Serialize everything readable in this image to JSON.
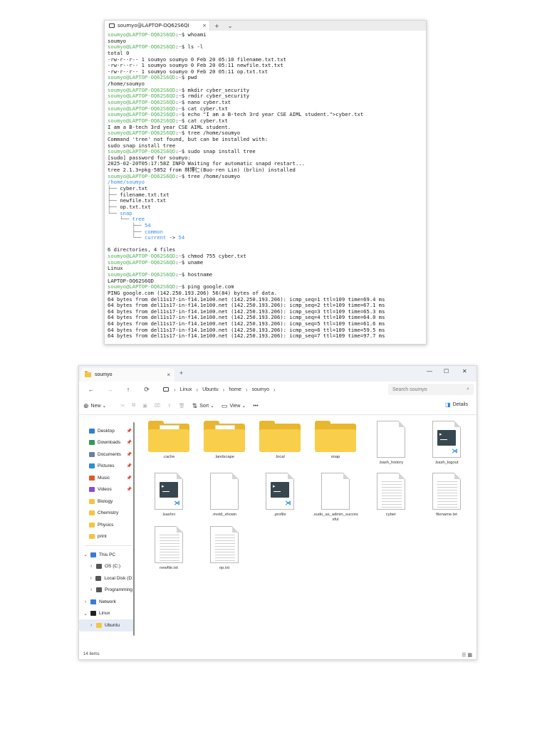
{
  "terminal": {
    "tab_title": "soumyo@LAPTOP-OQ62S6QI",
    "close": "×",
    "plus": "+",
    "dropdown": "⌄",
    "lines": [
      [
        {
          "t": "soumyo@LAPTOP-OQ62S6QD",
          "c": "u"
        },
        {
          "t": ":",
          "c": ""
        },
        {
          "t": "~",
          "c": "p"
        },
        {
          "t": "$ whoami",
          "c": ""
        }
      ],
      [
        {
          "t": "soumyo",
          "c": ""
        }
      ],
      [
        {
          "t": "soumyo@LAPTOP-OQ62S6QD",
          "c": "u"
        },
        {
          "t": ":",
          "c": ""
        },
        {
          "t": "~",
          "c": "p"
        },
        {
          "t": "$ ls -l",
          "c": ""
        }
      ],
      [
        {
          "t": "total 0",
          "c": ""
        }
      ],
      [
        {
          "t": "-rw-r--r-- 1 soumyo soumyo 0 Feb 20 05:10 filename.txt.txt",
          "c": ""
        }
      ],
      [
        {
          "t": "-rw-r--r-- 1 soumyo soumyo 0 Feb 20 05:11 newfile.txt.txt",
          "c": ""
        }
      ],
      [
        {
          "t": "-rw-r--r-- 1 soumyo soumyo 0 Feb 20 05:11 op.txt.txt",
          "c": ""
        }
      ],
      [
        {
          "t": "soumyo@LAPTOP-OQ62S6QD",
          "c": "u"
        },
        {
          "t": ":",
          "c": ""
        },
        {
          "t": "~",
          "c": "p"
        },
        {
          "t": "$ pwd",
          "c": ""
        }
      ],
      [
        {
          "t": "/home/soumyo",
          "c": ""
        }
      ],
      [
        {
          "t": "soumyo@LAPTOP-OQ62S6QD",
          "c": "u"
        },
        {
          "t": ":",
          "c": ""
        },
        {
          "t": "~",
          "c": "p"
        },
        {
          "t": "$ mkdir cyber_security",
          "c": ""
        }
      ],
      [
        {
          "t": "soumyo@LAPTOP-OQ62S6QD",
          "c": "u"
        },
        {
          "t": ":",
          "c": ""
        },
        {
          "t": "~",
          "c": "p"
        },
        {
          "t": "$ rmdir cyber_security",
          "c": ""
        }
      ],
      [
        {
          "t": "soumyo@LAPTOP-OQ62S6QD",
          "c": "u"
        },
        {
          "t": ":",
          "c": ""
        },
        {
          "t": "~",
          "c": "p"
        },
        {
          "t": "$ nano cyber.txt",
          "c": ""
        }
      ],
      [
        {
          "t": "soumyo@LAPTOP-OQ62S6QD",
          "c": "u"
        },
        {
          "t": ":",
          "c": ""
        },
        {
          "t": "~",
          "c": "p"
        },
        {
          "t": "$ cat cyber.txt",
          "c": ""
        }
      ],
      [
        {
          "t": "soumyo@LAPTOP-OQ62S6QD",
          "c": "u"
        },
        {
          "t": ":",
          "c": ""
        },
        {
          "t": "~",
          "c": "p"
        },
        {
          "t": "$ echo \"I am a B-tech 3rd year CSE AIML student.\">cyber.txt",
          "c": ""
        }
      ],
      [
        {
          "t": "soumyo@LAPTOP-OQ62S6QD",
          "c": "u"
        },
        {
          "t": ":",
          "c": ""
        },
        {
          "t": "~",
          "c": "p"
        },
        {
          "t": "$ cat cyber.txt",
          "c": ""
        }
      ],
      [
        {
          "t": "I am a B-tech 3rd year CSE AIML student.",
          "c": ""
        }
      ],
      [
        {
          "t": "soumyo@LAPTOP-OQ62S6QD",
          "c": "u"
        },
        {
          "t": ":",
          "c": ""
        },
        {
          "t": "~",
          "c": "p"
        },
        {
          "t": "$ tree /home/soumyo",
          "c": ""
        }
      ],
      [
        {
          "t": "Command 'tree' not found, but can be installed with:",
          "c": ""
        }
      ],
      [
        {
          "t": "sudo snap install tree",
          "c": ""
        }
      ],
      [
        {
          "t": "soumyo@LAPTOP-OQ62S6QD",
          "c": "u"
        },
        {
          "t": ":",
          "c": ""
        },
        {
          "t": "~",
          "c": "p"
        },
        {
          "t": "$ sudo snap install tree",
          "c": ""
        }
      ],
      [
        {
          "t": "[sudo] password for soumyo:",
          "c": ""
        }
      ],
      [
        {
          "t": "2025-02-20T05:17:58Z INFO Waiting for automatic snapd restart...",
          "c": ""
        }
      ],
      [
        {
          "t": "tree 2.1.3+pkg-5852 from 林博仁(Buo-ren Lin) (brlin) installed",
          "c": ""
        }
      ],
      [
        {
          "t": "soumyo@LAPTOP-OQ62S6QD",
          "c": "u"
        },
        {
          "t": ":",
          "c": ""
        },
        {
          "t": "~",
          "c": "p"
        },
        {
          "t": "$ tree /home/soumyo",
          "c": ""
        }
      ],
      [
        {
          "t": "/home/soumyo",
          "c": "d"
        }
      ],
      [
        {
          "t": "├── ",
          "c": "g"
        },
        {
          "t": "cyber.txt",
          "c": ""
        }
      ],
      [
        {
          "t": "├── ",
          "c": "g"
        },
        {
          "t": "filename.txt.txt",
          "c": ""
        }
      ],
      [
        {
          "t": "├── ",
          "c": "g"
        },
        {
          "t": "newfile.txt.txt",
          "c": ""
        }
      ],
      [
        {
          "t": "├── ",
          "c": "g"
        },
        {
          "t": "op.txt.txt",
          "c": ""
        }
      ],
      [
        {
          "t": "└── ",
          "c": "g"
        },
        {
          "t": "snap",
          "c": "d"
        }
      ],
      [
        {
          "t": "    └── ",
          "c": "g"
        },
        {
          "t": "tree",
          "c": "d"
        }
      ],
      [
        {
          "t": "        ├── ",
          "c": "g"
        },
        {
          "t": "54",
          "c": "d"
        }
      ],
      [
        {
          "t": "        ├── ",
          "c": "g"
        },
        {
          "t": "common",
          "c": "d"
        }
      ],
      [
        {
          "t": "        └── ",
          "c": "g"
        },
        {
          "t": "current",
          "c": "d"
        },
        {
          "t": " -> ",
          "c": ""
        },
        {
          "t": "54",
          "c": "d"
        }
      ],
      [
        {
          "t": "",
          "c": ""
        }
      ],
      [
        {
          "t": "6 directories, 4 files",
          "c": ""
        }
      ],
      [
        {
          "t": "soumyo@LAPTOP-OQ62S6QD",
          "c": "u"
        },
        {
          "t": ":",
          "c": ""
        },
        {
          "t": "~",
          "c": "p"
        },
        {
          "t": "$ chmod 755 cyber.txt",
          "c": ""
        }
      ],
      [
        {
          "t": "soumyo@LAPTOP-OQ62S6QD",
          "c": "u"
        },
        {
          "t": ":",
          "c": ""
        },
        {
          "t": "~",
          "c": "p"
        },
        {
          "t": "$ uname",
          "c": ""
        }
      ],
      [
        {
          "t": "Linux",
          "c": ""
        }
      ],
      [
        {
          "t": "soumyo@LAPTOP-OQ62S6QD",
          "c": "u"
        },
        {
          "t": ":",
          "c": ""
        },
        {
          "t": "~",
          "c": "p"
        },
        {
          "t": "$ hostname",
          "c": ""
        }
      ],
      [
        {
          "t": "LAPTOP-OQ62S6QD",
          "c": ""
        }
      ],
      [
        {
          "t": "soumyo@LAPTOP-OQ62S6QD",
          "c": "u"
        },
        {
          "t": ":",
          "c": ""
        },
        {
          "t": "~",
          "c": "p"
        },
        {
          "t": "$ ping google.com",
          "c": ""
        }
      ],
      [
        {
          "t": "PING google.com (142.250.193.206) 56(84) bytes of data.",
          "c": ""
        }
      ],
      [
        {
          "t": "64 bytes from del11s17-in-f14.1e100.net (142.250.193.206): icmp_seq=1 ttl=109 time=69.4 ms",
          "c": ""
        }
      ],
      [
        {
          "t": "64 bytes from del11s17-in-f14.1e100.net (142.250.193.206): icmp_seq=2 ttl=109 time=67.1 ms",
          "c": ""
        }
      ],
      [
        {
          "t": "64 bytes from del11s17-in-f14.1e100.net (142.250.193.206): icmp_seq=3 ttl=109 time=65.3 ms",
          "c": ""
        }
      ],
      [
        {
          "t": "64 bytes from del11s17-in-f14.1e100.net (142.250.193.206): icmp_seq=4 ttl=109 time=64.0 ms",
          "c": ""
        }
      ],
      [
        {
          "t": "64 bytes from del11s17-in-f14.1e100.net (142.250.193.206): icmp_seq=5 ttl=109 time=61.6 ms",
          "c": ""
        }
      ],
      [
        {
          "t": "64 bytes from del11s17-in-f14.1e100.net (142.250.193.206): icmp_seq=6 ttl=109 time=59.5 ms",
          "c": ""
        }
      ],
      [
        {
          "t": "64 bytes from del11s17-in-f14.1e100.net (142.250.193.206): icmp_seq=7 ttl=109 time=97.7 ms",
          "c": ""
        }
      ]
    ]
  },
  "explorer": {
    "tab_title": "soumyo",
    "tab_close": "×",
    "new_tab": "+",
    "win_min": "—",
    "win_max": "☐",
    "win_close": "✕",
    "nav": {
      "back": "←",
      "forward": "→",
      "up": "↑",
      "refresh": "⟳"
    },
    "breadcrumb": [
      "Linux",
      "Ubuntu",
      "home",
      "soumyo"
    ],
    "breadcrumb_sep": "›",
    "search_placeholder": "Search soumyo",
    "toolbar": {
      "new_label": "New",
      "sort_label": "Sort",
      "view_label": "View",
      "more": "•••",
      "details_label": "Details"
    },
    "sidebar": [
      {
        "label": "Desktop",
        "icon": "desktop-icon",
        "color": "#2f7fd8",
        "pinned": true
      },
      {
        "label": "Downloads",
        "icon": "download-icon",
        "color": "#2e9a5b",
        "pinned": true
      },
      {
        "label": "Documents",
        "icon": "documents-icon",
        "color": "#6a7fa0",
        "pinned": true
      },
      {
        "label": "Pictures",
        "icon": "pictures-icon",
        "color": "#2a8fd6",
        "pinned": true
      },
      {
        "label": "Music",
        "icon": "music-icon",
        "color": "#e4572e",
        "pinned": true
      },
      {
        "label": "Videos",
        "icon": "videos-icon",
        "color": "#8b4bd6",
        "pinned": true
      },
      {
        "label": "Biology",
        "icon": "folder-icon",
        "color": "#f4c542",
        "pinned": false
      },
      {
        "label": "Chemistry",
        "icon": "folder-icon",
        "color": "#f4c542",
        "pinned": false
      },
      {
        "label": "Physics",
        "icon": "folder-icon",
        "color": "#f4c542",
        "pinned": false
      },
      {
        "label": "print",
        "icon": "folder-icon",
        "color": "#f4c542",
        "pinned": false
      }
    ],
    "tree": [
      {
        "label": "This PC",
        "chev": "⌄",
        "indent": 0,
        "icon": "pc-icon",
        "color": "#3a7bd5"
      },
      {
        "label": "OS (C:)",
        "chev": "›",
        "indent": 1,
        "icon": "drive-icon",
        "color": "#555555"
      },
      {
        "label": "Local Disk (D:)",
        "chev": "›",
        "indent": 1,
        "icon": "drive-icon",
        "color": "#555555"
      },
      {
        "label": "Programming",
        "chev": "›",
        "indent": 1,
        "icon": "drive-icon",
        "color": "#555555"
      },
      {
        "label": "Network",
        "chev": "›",
        "indent": 0,
        "icon": "network-icon",
        "color": "#3a7bd5"
      },
      {
        "label": "Linux",
        "chev": "⌄",
        "indent": 0,
        "icon": "linux-icon",
        "color": "#222222"
      },
      {
        "label": "Ubuntu",
        "chev": "›",
        "indent": 1,
        "icon": "folder-icon",
        "color": "#f4c542",
        "selected": true
      }
    ],
    "items": [
      {
        "name": ".cache",
        "kind": "folder"
      },
      {
        "name": ".landscape",
        "kind": "folder"
      },
      {
        "name": ".local",
        "kind": "folder-empty"
      },
      {
        "name": "snap",
        "kind": "folder-empty"
      },
      {
        "name": ".bash_history",
        "kind": "blank"
      },
      {
        "name": ".bash_logout",
        "kind": "code"
      },
      {
        "name": ".bashrc",
        "kind": "code"
      },
      {
        "name": ".motd_shown",
        "kind": "blank"
      },
      {
        "name": ".profile",
        "kind": "code"
      },
      {
        "name": ".sudo_as_admin_successful",
        "kind": "blank"
      },
      {
        "name": "cyber",
        "kind": "text"
      },
      {
        "name": "filename.txt",
        "kind": "text"
      },
      {
        "name": "newfile.txt",
        "kind": "text"
      },
      {
        "name": "op.txt",
        "kind": "text"
      }
    ],
    "status": "14 items"
  }
}
